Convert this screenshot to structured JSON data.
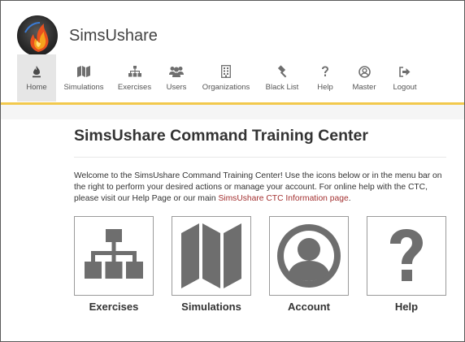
{
  "app": {
    "name": "SimsUshare"
  },
  "nav": {
    "items": [
      {
        "label": "Home",
        "icon": "fire-icon",
        "active": true
      },
      {
        "label": "Simulations",
        "icon": "map-icon",
        "active": false
      },
      {
        "label": "Exercises",
        "icon": "sitemap-icon",
        "active": false
      },
      {
        "label": "Users",
        "icon": "users-icon",
        "active": false
      },
      {
        "label": "Organizations",
        "icon": "building-icon",
        "active": false
      },
      {
        "label": "Black List",
        "icon": "gavel-icon",
        "active": false
      },
      {
        "label": "Help",
        "icon": "question-icon",
        "active": false
      },
      {
        "label": "Master",
        "icon": "user-circle-icon",
        "active": false
      },
      {
        "label": "Logout",
        "icon": "logout-icon",
        "active": false
      }
    ]
  },
  "main": {
    "title": "SimsUshare Command Training Center",
    "intro_text": "Welcome to the SimsUshare Command Training Center! Use the icons below or in the menu bar on the right to perform your desired actions or manage your account. For online help with the CTC, please visit our Help Page or our main ",
    "intro_link": "SimsUshare CTC Information page",
    "intro_end": ".",
    "tiles": [
      {
        "label": "Exercises",
        "icon": "sitemap-icon"
      },
      {
        "label": "Simulations",
        "icon": "map-icon"
      },
      {
        "label": "Account",
        "icon": "user-circle-icon"
      },
      {
        "label": "Help",
        "icon": "question-icon"
      }
    ]
  },
  "colors": {
    "accent": "#f2c94c",
    "link": "#a33030",
    "icon": "#6e6e6e"
  }
}
